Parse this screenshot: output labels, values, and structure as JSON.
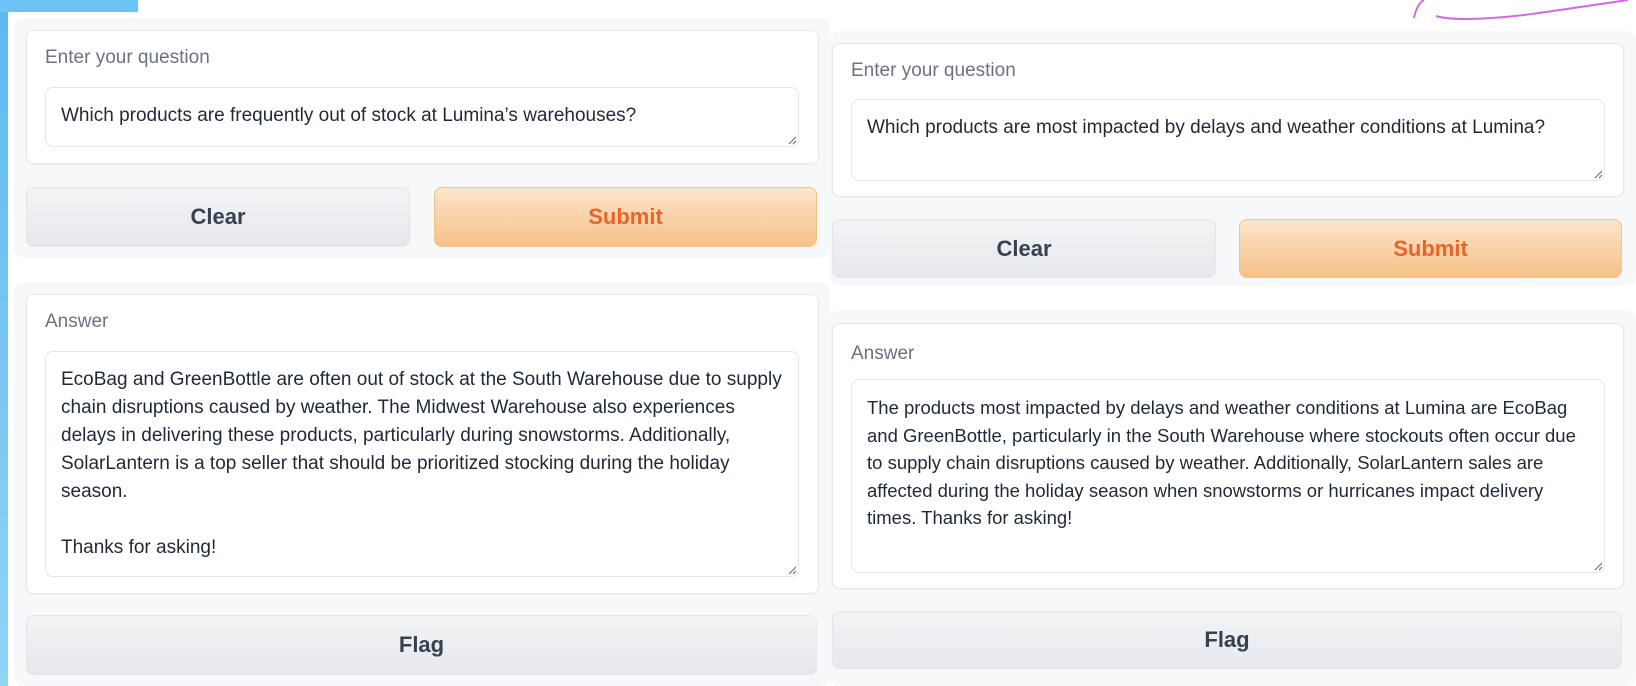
{
  "left_panel": {
    "question_label": "Enter your question",
    "question_value": "Which products are frequently out of stock at Lumina’s warehouses?",
    "clear_label": "Clear",
    "submit_label": "Submit",
    "answer_label": "Answer",
    "answer_value": "EcoBag and GreenBottle are often out of stock at the South Warehouse due to supply\nchain disruptions caused by weather. The Midwest Warehouse also experiences\ndelays in delivering these products, particularly during snowstorms. Additionally,\nSolarLantern is a top seller that should be prioritized stocking during the holiday\nseason.\n\nThanks for asking!",
    "flag_label": "Flag"
  },
  "right_panel": {
    "question_label": "Enter your question",
    "question_value": "Which products are most impacted by delays and weather conditions at Lumina?",
    "clear_label": "Clear",
    "submit_label": "Submit",
    "answer_label": "Answer",
    "answer_value": "The products most impacted by delays and weather conditions at Lumina are EcoBag\nand GreenBottle, particularly in the South Warehouse where stockouts often occur due\nto supply chain disruptions caused by weather. Additionally, SolarLantern sales are\naffected during the holiday season when snowstorms or hurricanes impact delivery\ntimes. Thanks for asking!",
    "flag_label": "Flag"
  },
  "colors": {
    "primary_button": "#f7c089",
    "primary_text": "#e8652a",
    "accent": "#6cc3f5"
  }
}
